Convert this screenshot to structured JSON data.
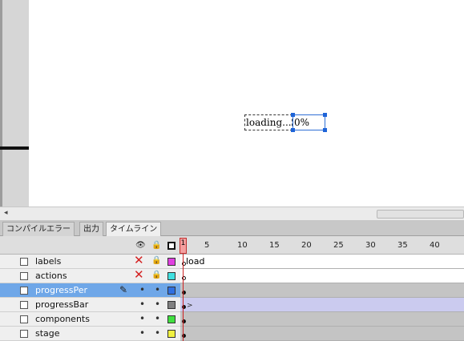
{
  "stage": {
    "loading_text": "loading...",
    "percent_text": "0%"
  },
  "scroll": {
    "left_arrow": "◂"
  },
  "tabs": [
    {
      "label": "コンパイルエラー",
      "active": false
    },
    {
      "label": "出力",
      "active": false
    },
    {
      "label": "タイムライン",
      "active": true
    }
  ],
  "timeline": {
    "frame_numbers": [
      "1",
      "5",
      "10",
      "15",
      "20",
      "25",
      "30",
      "35",
      "40"
    ],
    "header_icons": {
      "eye": "eye-icon",
      "lock": "lock-icon",
      "outline": "outline-icon"
    },
    "layers": [
      {
        "name": "labels",
        "hidden": true,
        "locked": true,
        "color": "#e040e0",
        "label": "load",
        "selected": false
      },
      {
        "name": "actions",
        "hidden": true,
        "locked": true,
        "color": "#40e0e0",
        "label": "",
        "selected": false
      },
      {
        "name": "progressPer",
        "hidden": false,
        "locked": false,
        "color": "#3070e0",
        "label": "",
        "selected": true
      },
      {
        "name": "progressBar",
        "hidden": false,
        "locked": false,
        "color": "#808080",
        "label": "",
        "selected": false
      },
      {
        "name": "components",
        "hidden": false,
        "locked": false,
        "color": "#40e040",
        "label": "",
        "selected": false
      },
      {
        "name": "stage",
        "hidden": false,
        "locked": false,
        "color": "#f0f040",
        "label": "",
        "selected": false
      }
    ]
  }
}
